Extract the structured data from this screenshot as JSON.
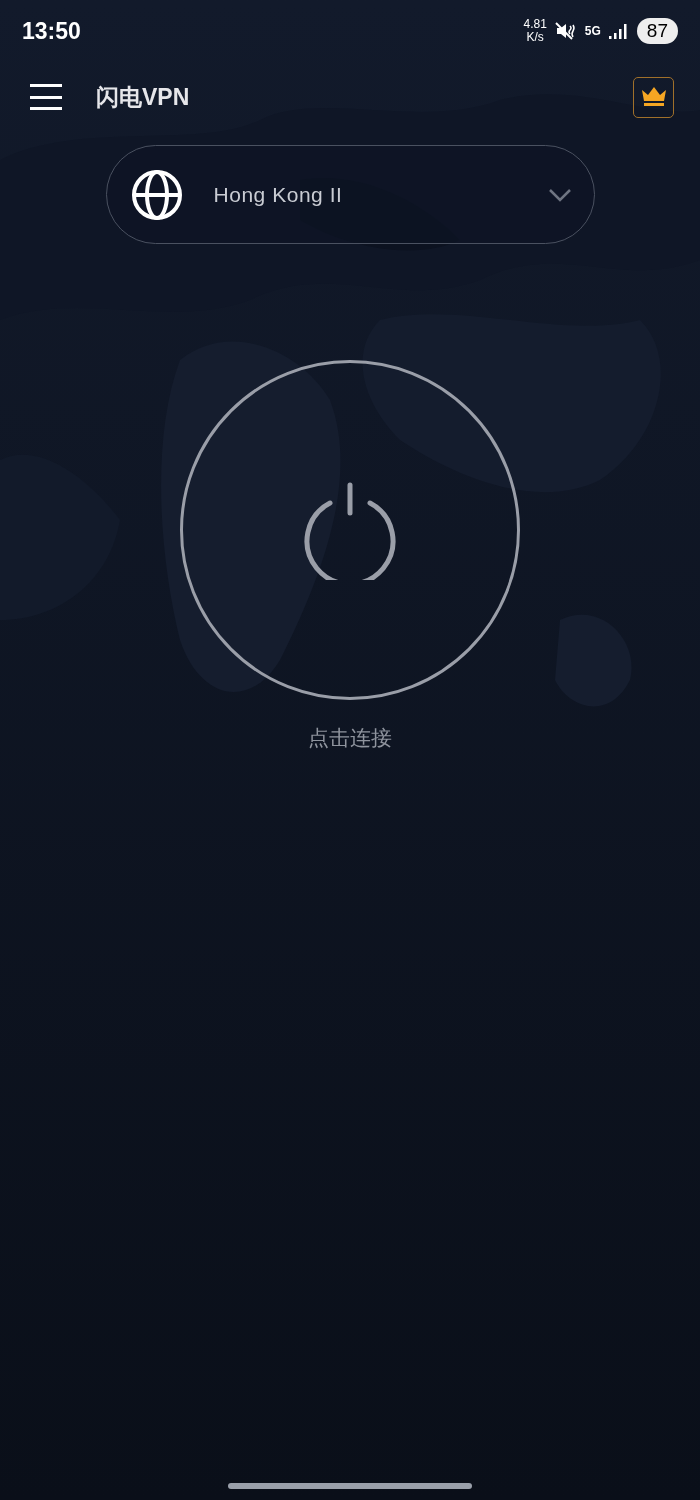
{
  "status_bar": {
    "time": "13:50",
    "speed_value": "4.81",
    "speed_unit": "K/s",
    "network": "5G",
    "battery": "87"
  },
  "app_bar": {
    "title": "闪电VPN"
  },
  "server_selector": {
    "label": "Hong Kong II"
  },
  "connect": {
    "connected": false,
    "label": "点击连接"
  }
}
